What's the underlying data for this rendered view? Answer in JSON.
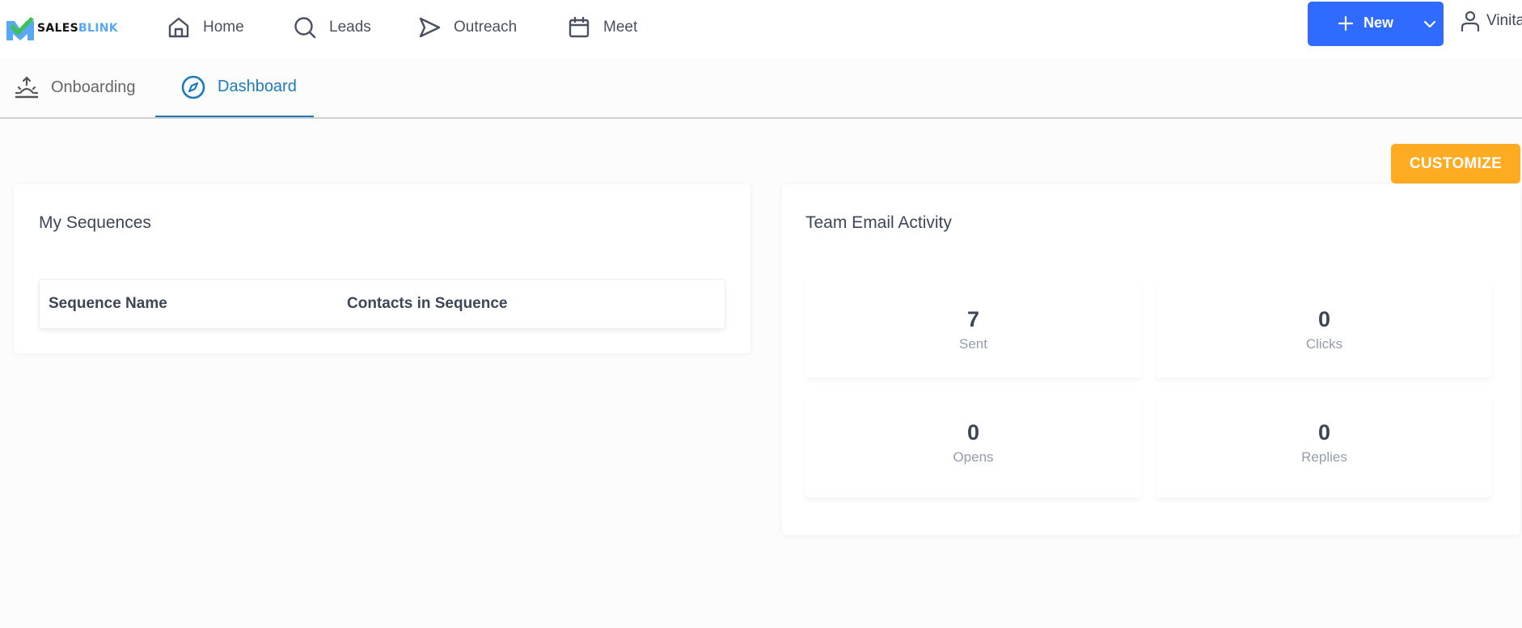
{
  "brand": {
    "name_part1": "SALES",
    "name_part2": "BLINK"
  },
  "nav": {
    "items": [
      {
        "label": "Home",
        "icon": "home-icon"
      },
      {
        "label": "Leads",
        "icon": "search-icon"
      },
      {
        "label": "Outreach",
        "icon": "send-icon"
      },
      {
        "label": "Meet",
        "icon": "calendar-icon"
      }
    ],
    "new_button_label": "New",
    "user_name": "Vinita"
  },
  "tabs": [
    {
      "label": "Onboarding",
      "icon": "sunrise-icon",
      "active": false
    },
    {
      "label": "Dashboard",
      "icon": "compass-icon",
      "active": true
    }
  ],
  "toolbar": {
    "customize_label": "CUSTOMIZE"
  },
  "my_sequences": {
    "title": "My Sequences",
    "columns": [
      "Sequence Name",
      "Contacts in Sequence"
    ],
    "rows": []
  },
  "team_email_activity": {
    "title": "Team Email Activity",
    "stats": [
      {
        "value": "7",
        "label": "Sent"
      },
      {
        "value": "0",
        "label": "Clicks"
      },
      {
        "value": "0",
        "label": "Opens"
      },
      {
        "value": "0",
        "label": "Replies"
      }
    ]
  },
  "colors": {
    "primary": "#2f6bff",
    "accent": "#fdab21",
    "active_tab": "#1a7bbf",
    "text": "#3d4657",
    "muted": "#959cab"
  }
}
